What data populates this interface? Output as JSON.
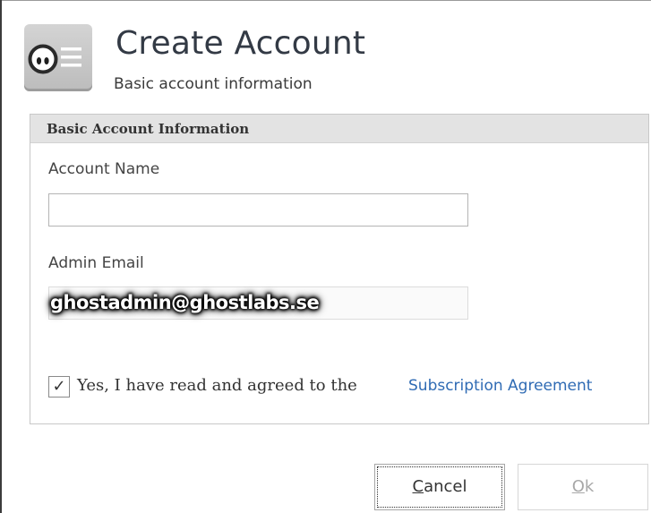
{
  "header": {
    "title": "Create Account",
    "subtitle": "Basic account information",
    "icon": "account-card-icon"
  },
  "group": {
    "title": "Basic Account Information"
  },
  "fields": {
    "account_name": {
      "label": "Account Name",
      "value": ""
    },
    "admin_email": {
      "label": "Admin Email",
      "value": "ghostadmin@ghostlabs.se",
      "disabled": true
    }
  },
  "agreement": {
    "checked": true,
    "checkmark": "✓",
    "text": "Yes, I have read and agreed to the",
    "link_text": "Subscription Agreement"
  },
  "buttons": {
    "cancel": {
      "mnemonic": "C",
      "rest": "ancel"
    },
    "ok": {
      "mnemonic": "O",
      "rest": "k",
      "enabled": false
    }
  },
  "colors": {
    "link": "#2f6bb4",
    "group_header_bg": "#e3e3e3",
    "title": "#333a45"
  }
}
